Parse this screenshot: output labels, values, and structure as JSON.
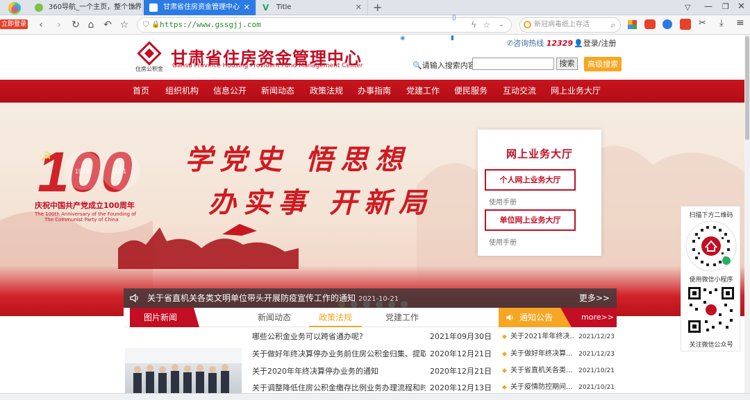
{
  "browser": {
    "login_badge": "立即登录",
    "tabs": [
      {
        "label": "360导航_一个主页，整个世界"
      },
      {
        "label": "甘肃省住房资金管理中心"
      },
      {
        "label": "Title"
      }
    ],
    "new_tab_symbol": "+",
    "url": "https://www.gssgjj.com",
    "search_hint": "新冠病毒纸上存活"
  },
  "header": {
    "logo_text": "住房公积金",
    "title_cn": "甘肃省住房资金管理中心",
    "title_en": "Gansu Province Housing Provident Fund Management Center",
    "hotline_label": "咨询热线",
    "hotline_number": "12329",
    "login_label": "登录/注册",
    "search_label": "请输入搜索内容",
    "search_button": "搜索",
    "advanced_button": "高级搜索"
  },
  "nav": [
    {
      "label": "首页"
    },
    {
      "label": "组织机构"
    },
    {
      "label": "信息公开"
    },
    {
      "label": "新闻动态"
    },
    {
      "label": "政策法规"
    },
    {
      "label": "办事指南"
    },
    {
      "label": "党建工作"
    },
    {
      "label": "便民服务"
    },
    {
      "label": "互动交流"
    },
    {
      "label": "网上业务大厅"
    }
  ],
  "banner": {
    "badge_number": "100",
    "badge_year1": "1921",
    "badge_year2": "2021",
    "anniv_cn": "庆祝中国共产党成立100周年",
    "anniv_en1": "The 100th Anniversary of the Founding of",
    "anniv_en2": "The Communist Party of China",
    "slogan1": "学党史 悟思想",
    "slogan2": "办实事 开新局",
    "hall_title": "网上业务大厅",
    "hall_personal": "个人网上业务大厅",
    "hall_personal_manual": "使用手册",
    "hall_unit": "单位网上业务大厅",
    "hall_unit_manual": "使用手册",
    "slide_count": 6,
    "active_slide": 1
  },
  "ticker": {
    "text": "关于省直机关各类文明单位带头开展防疫宣传工作的通知",
    "date": "2021-10-21",
    "more": "更多>>"
  },
  "news": {
    "pic_tab": "图片新闻",
    "tabs": [
      {
        "label": "新闻动态",
        "active": false
      },
      {
        "label": "政策法规",
        "active": true
      },
      {
        "label": "党建工作",
        "active": false
      }
    ],
    "items": [
      {
        "title": "哪些公积金业务可以跨省通办呢?",
        "date": "2021年09月30日"
      },
      {
        "title": "关于做好年终决算停办业务前住房公积金归集、提取业...",
        "date": "2020年12月21日"
      },
      {
        "title": "关于2020年年终决算停办业务的通知",
        "date": "2020年12月21日"
      },
      {
        "title": "关于调整降低住房公积金缴存比例业务办理流程和时限...",
        "date": "2020年12月13日"
      }
    ]
  },
  "notices": {
    "title": "通知公告",
    "more": "more>>",
    "items": [
      {
        "title": "关于2021年年终决...",
        "date": "2021/12/23"
      },
      {
        "title": "关于做好年终决算...",
        "date": "2021/12/23"
      },
      {
        "title": "关于省直机关各类...",
        "date": "2021/10/21"
      },
      {
        "title": "关于疫情防控期间...",
        "date": "2021/10/21"
      }
    ]
  },
  "qr": {
    "scan_hint": "扫描下方二维码",
    "miniprogram": "使用微信小程序",
    "official": "关注微信公众号"
  },
  "colors": {
    "brand_red": "#c30d23",
    "accent_orange": "#f5a623",
    "browser_blue": "#2c7be5"
  }
}
